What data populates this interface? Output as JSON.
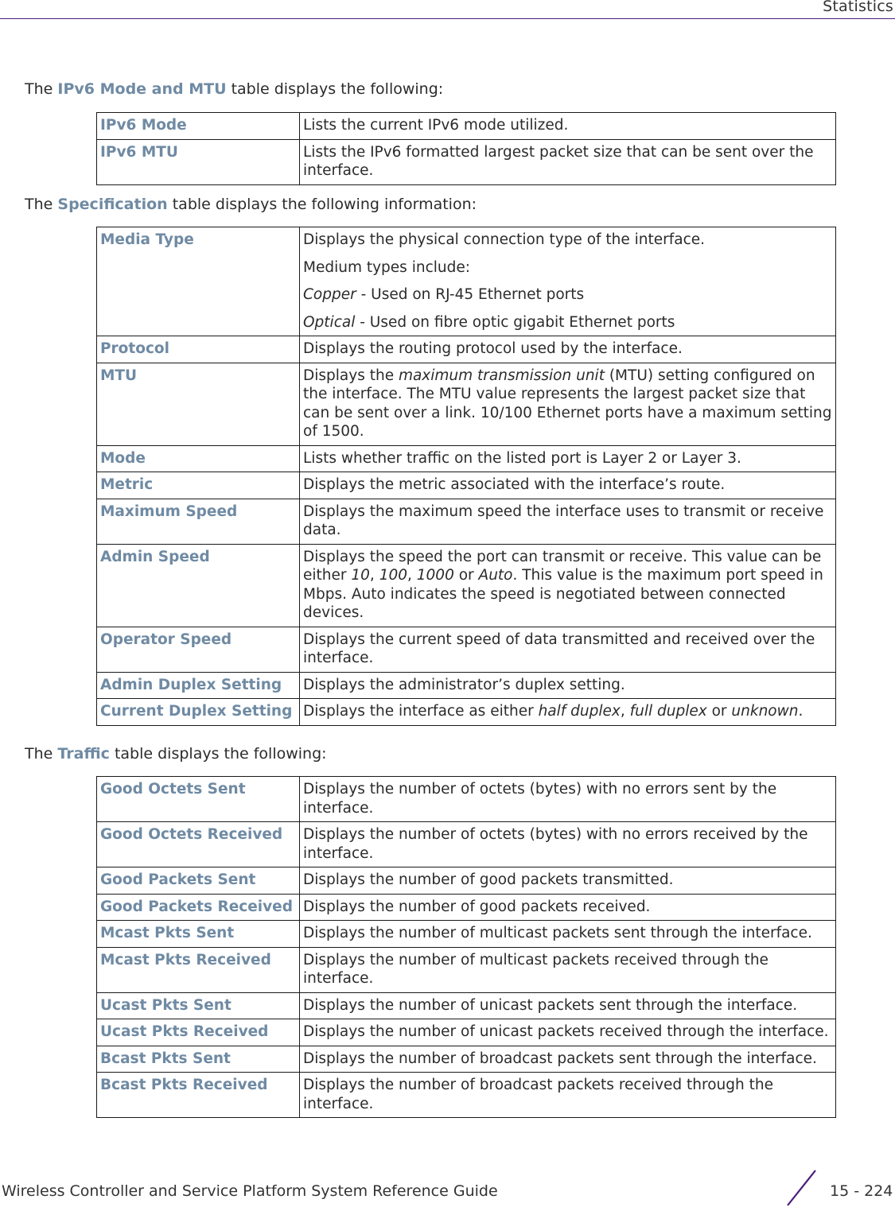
{
  "header": {
    "title": "Statistics"
  },
  "sections": [
    {
      "intro": {
        "prefix": "The ",
        "keyword": "IPv6 Mode and MTU",
        "suffix": " table displays the following:"
      },
      "rows": [
        {
          "term": "IPv6 Mode",
          "desc": [
            [
              {
                "t": "Lists the current IPv6 mode utilized."
              }
            ]
          ]
        },
        {
          "term": "IPv6 MTU",
          "desc": [
            [
              {
                "t": "Lists the IPv6 formatted largest packet size that can be sent over the interface."
              }
            ]
          ]
        }
      ]
    },
    {
      "intro": {
        "prefix": "The ",
        "keyword": "Specification",
        "suffix": " table displays the following information:"
      },
      "rows": [
        {
          "term": "Media Type",
          "desc": [
            [
              {
                "t": "Displays the physical connection type of the interface."
              }
            ],
            [
              {
                "t": "Medium types include:"
              }
            ],
            [
              {
                "t": "Copper",
                "i": true
              },
              {
                "t": " - Used on RJ-45 Ethernet ports"
              }
            ],
            [
              {
                "t": "Optical",
                "i": true
              },
              {
                "t": " - Used on fibre optic gigabit Ethernet ports"
              }
            ]
          ]
        },
        {
          "term": "Protocol",
          "desc": [
            [
              {
                "t": "Displays the routing protocol used by the interface."
              }
            ]
          ]
        },
        {
          "term": "MTU",
          "desc": [
            [
              {
                "t": "Displays the "
              },
              {
                "t": "maximum transmission unit",
                "i": true
              },
              {
                "t": " (MTU) setting configured on the interface. The MTU value represents the largest packet size that can be sent over a link. 10/100 Ethernet ports have a maximum setting of 1500."
              }
            ]
          ]
        },
        {
          "term": "Mode",
          "desc": [
            [
              {
                "t": "Lists whether traffic on the listed port is Layer 2 or Layer 3."
              }
            ]
          ]
        },
        {
          "term": "Metric",
          "desc": [
            [
              {
                "t": "Displays the metric associated with the interface’s route."
              }
            ]
          ]
        },
        {
          "term": "Maximum Speed",
          "desc": [
            [
              {
                "t": "Displays the maximum speed the interface uses to transmit or receive data."
              }
            ]
          ]
        },
        {
          "term": "Admin Speed",
          "desc": [
            [
              {
                "t": "Displays the speed the port can transmit or receive. This value can be either "
              },
              {
                "t": "10",
                "i": true
              },
              {
                "t": ", "
              },
              {
                "t": "100",
                "i": true
              },
              {
                "t": ", "
              },
              {
                "t": "1000",
                "i": true
              },
              {
                "t": " or "
              },
              {
                "t": "Auto",
                "i": true
              },
              {
                "t": ". This value is the maximum port speed in Mbps. Auto indicates the speed is negotiated between connected devices."
              }
            ]
          ]
        },
        {
          "term": "Operator Speed",
          "desc": [
            [
              {
                "t": "Displays the current speed of data transmitted and received over the interface."
              }
            ]
          ]
        },
        {
          "term": "Admin Duplex Setting",
          "desc": [
            [
              {
                "t": "Displays the administrator’s duplex setting."
              }
            ]
          ]
        },
        {
          "term": "Current Duplex Setting",
          "desc": [
            [
              {
                "t": "Displays the interface as either "
              },
              {
                "t": "half duplex",
                "i": true
              },
              {
                "t": ", "
              },
              {
                "t": "full duplex",
                "i": true
              },
              {
                "t": " or "
              },
              {
                "t": "unknown",
                "i": true
              },
              {
                "t": "."
              }
            ]
          ]
        }
      ]
    },
    {
      "intro": {
        "prefix": "The ",
        "keyword": "Traffic",
        "suffix": " table displays the following:"
      },
      "rows": [
        {
          "term": "Good Octets Sent",
          "desc": [
            [
              {
                "t": "Displays the number of octets (bytes) with no errors sent by the interface."
              }
            ]
          ]
        },
        {
          "term": "Good Octets Received",
          "desc": [
            [
              {
                "t": "Displays the number of octets (bytes) with no errors received by the interface."
              }
            ]
          ]
        },
        {
          "term": "Good Packets Sent",
          "desc": [
            [
              {
                "t": "Displays the number of good packets transmitted."
              }
            ]
          ]
        },
        {
          "term": "Good Packets Received",
          "desc": [
            [
              {
                "t": "Displays the number of good packets received."
              }
            ]
          ]
        },
        {
          "term": "Mcast Pkts Sent",
          "desc": [
            [
              {
                "t": "Displays the number of multicast packets sent through the interface."
              }
            ]
          ]
        },
        {
          "term": "Mcast Pkts Received",
          "desc": [
            [
              {
                "t": "Displays the number of multicast packets received through the interface."
              }
            ]
          ]
        },
        {
          "term": "Ucast Pkts Sent",
          "desc": [
            [
              {
                "t": "Displays the number of unicast packets sent through the interface."
              }
            ]
          ]
        },
        {
          "term": "Ucast Pkts Received",
          "desc": [
            [
              {
                "t": "Displays the number of unicast packets received through the interface."
              }
            ]
          ]
        },
        {
          "term": "Bcast Pkts Sent",
          "desc": [
            [
              {
                "t": "Displays the number of broadcast packets sent through the interface."
              }
            ]
          ]
        },
        {
          "term": "Bcast Pkts Received",
          "desc": [
            [
              {
                "t": "Displays the number of broadcast packets received through the interface."
              }
            ]
          ]
        }
      ]
    }
  ],
  "footer": {
    "guide_title": "Wireless Controller and Service Platform System Reference Guide",
    "page_number": "15 - 224",
    "accent_color": "#4b1e78",
    "keyword_color": "#6f8aa3"
  }
}
